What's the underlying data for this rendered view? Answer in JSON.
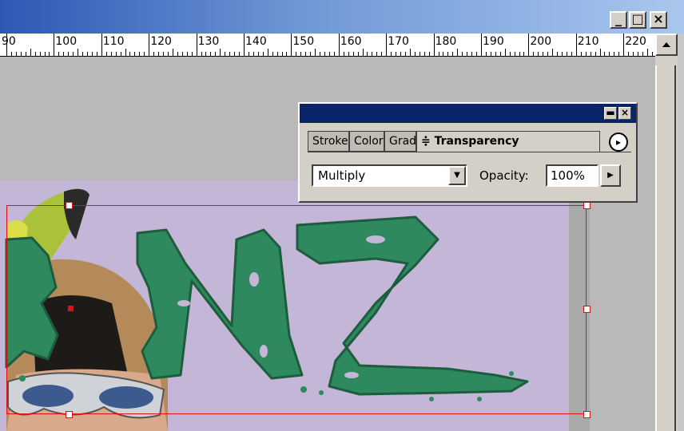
{
  "window": {
    "minimize_glyph": "_",
    "maximize_glyph": "□",
    "close_glyph": "×"
  },
  "ruler": {
    "labels": [
      "90",
      "100",
      "110",
      "120",
      "130",
      "140",
      "150",
      "160",
      "170",
      "180",
      "190",
      "200",
      "210",
      "220"
    ]
  },
  "palette": {
    "minimize_glyph": "▬",
    "close_glyph": "×",
    "tabs": [
      {
        "label": "Stroke",
        "active": false
      },
      {
        "label": "Color",
        "active": false
      },
      {
        "label": "Gradient",
        "active": false
      },
      {
        "label": "Transparency",
        "active": true
      }
    ],
    "active_tab_prefix": "≑",
    "menu_glyph": "▸",
    "blend_mode": "Multiply",
    "dropdown_glyph": "▼",
    "opacity_label": "Opacity:",
    "opacity_value": "100%",
    "opacity_arrow_glyph": "▶"
  },
  "canvas": {
    "artwork_text": "NZ",
    "selection_color": "#e01010",
    "artwork_color": "#2e8a5e",
    "page_color": "#c3b6d6"
  }
}
